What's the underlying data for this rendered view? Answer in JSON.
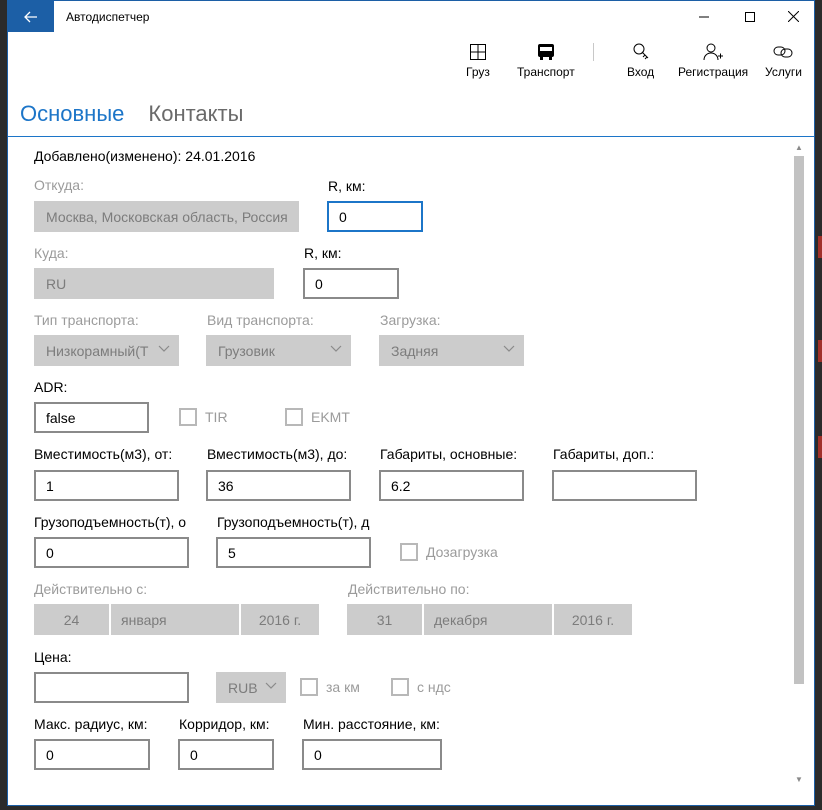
{
  "window": {
    "title": "Автодиспетчер",
    "accent": "#1c5fa6"
  },
  "toolbar": {
    "cargo_label": "Груз",
    "transport_label": "Транспорт",
    "login_label": "Вход",
    "register_label": "Регистрация",
    "services_label": "Услуги"
  },
  "tabs": {
    "main_label": "Основные",
    "contacts_label": "Контакты"
  },
  "form": {
    "added_label": "Добавлено(изменено): 24.01.2016",
    "from_label": "Откуда:",
    "from_value": "Москва, Московская область, Россия",
    "radius1_label": "R, км:",
    "radius1_value": "0",
    "to_label": "Куда:",
    "to_value": "RU",
    "radius2_label": "R, км:",
    "radius2_value": "0",
    "transport_type_label": "Тип транспорта:",
    "transport_type_value": "Низкорамный(Т",
    "transport_kind_label": "Вид транспорта:",
    "transport_kind_value": "Грузовик",
    "loading_label": "Загрузка:",
    "loading_value": "Задняя",
    "adr_label": "ADR:",
    "adr_value": "false",
    "tir_label": "TIR",
    "ekmt_label": "EKMT",
    "volume_from_label": "Вместимость(м3), от:",
    "volume_from_value": "1",
    "volume_to_label": "Вместимость(м3), до:",
    "volume_to_value": "36",
    "dims_main_label": "Габариты, основные:",
    "dims_main_value": "6.2",
    "dims_extra_label": "Габариты, доп.:",
    "dims_extra_value": "",
    "capacity_from_label": "Грузоподъемность(т), о",
    "capacity_from_value": "0",
    "capacity_to_label": "Грузоподъемность(т), д",
    "capacity_to_value": "5",
    "extra_load_label": "Дозагрузка",
    "valid_from_label": "Действительно с:",
    "valid_from_day": "24",
    "valid_from_month": "января",
    "valid_from_year": "2016 г.",
    "valid_to_label": "Действительно по:",
    "valid_to_day": "31",
    "valid_to_month": "декабря",
    "valid_to_year": "2016 г.",
    "price_label": "Цена:",
    "price_value": "",
    "currency_value": "RUB",
    "per_km_label": "за км",
    "vat_label": "с ндс",
    "max_radius_label": "Макс. радиус, км:",
    "max_radius_value": "0",
    "corridor_label": "Корридор, км:",
    "corridor_value": "0",
    "min_distance_label": "Мин. расстояние, км:",
    "min_distance_value": "0"
  }
}
